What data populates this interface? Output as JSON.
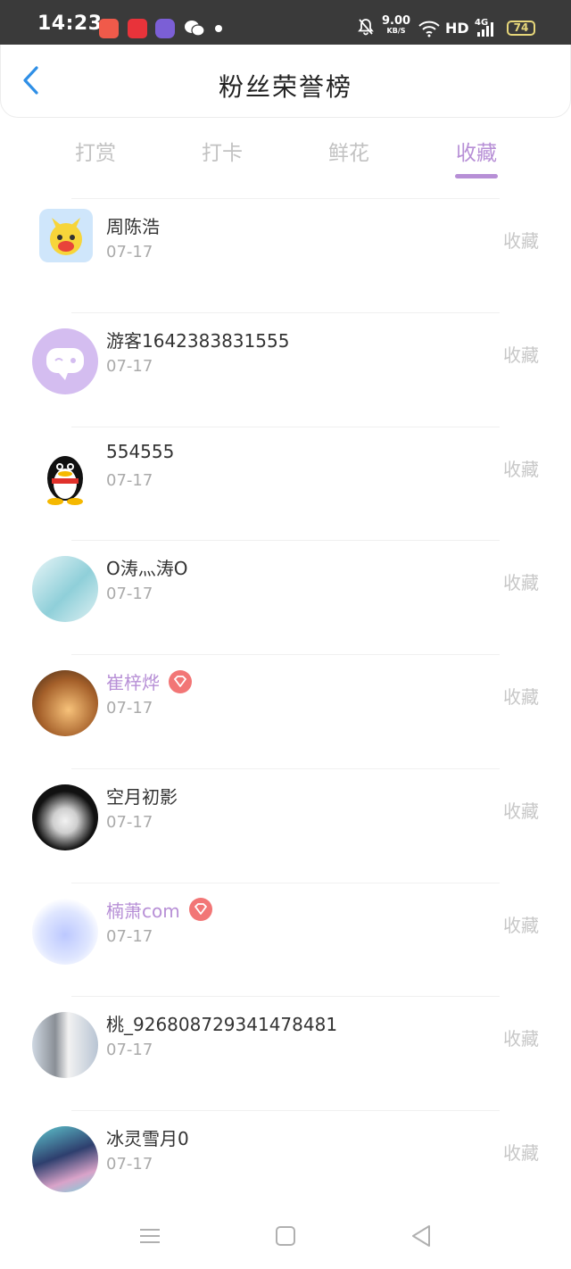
{
  "status_bar": {
    "time": "14:23",
    "speed_value": "9.00",
    "speed_unit": "KB/S",
    "network_label": "HD",
    "signal_label": "4G",
    "battery": "74"
  },
  "header": {
    "title": "粉丝荣誉榜",
    "back_icon": "chevron-left-icon"
  },
  "tabs": [
    {
      "label": "打赏",
      "active": false
    },
    {
      "label": "打卡",
      "active": false
    },
    {
      "label": "鲜花",
      "active": false
    },
    {
      "label": "收藏",
      "active": true
    }
  ],
  "list": [
    {
      "name": "周陈浩",
      "date": "07-17",
      "action": "收藏",
      "vip": false
    },
    {
      "name": "游客1642383831555",
      "date": "07-17",
      "action": "收藏",
      "vip": false
    },
    {
      "name": "554555",
      "date": "07-17",
      "action": "收藏",
      "vip": false
    },
    {
      "name": "O涛灬涛O",
      "date": "07-17",
      "action": "收藏",
      "vip": false
    },
    {
      "name": "崔梓烨",
      "date": "07-17",
      "action": "收藏",
      "vip": true
    },
    {
      "name": "空月初影",
      "date": "07-17",
      "action": "收藏",
      "vip": false
    },
    {
      "name": "楠萧com",
      "date": "07-17",
      "action": "收藏",
      "vip": true
    },
    {
      "name": "桃_926808729341478481",
      "date": "07-17",
      "action": "收藏",
      "vip": false
    },
    {
      "name": "冰灵雪月0",
      "date": "07-17",
      "action": "收藏",
      "vip": false
    }
  ],
  "colors": {
    "accent": "#b78fd6",
    "back_icon": "#2f8fe6",
    "inactive_tab": "#c2c2c2",
    "vip_badge": "#f27676"
  }
}
